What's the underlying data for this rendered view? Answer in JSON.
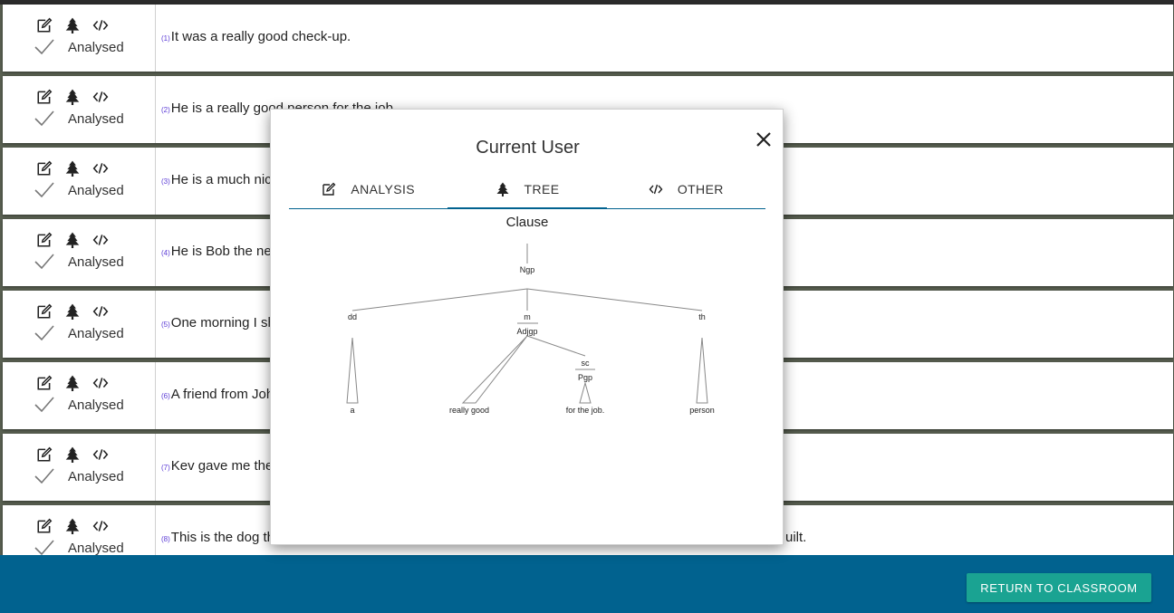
{
  "rows": [
    {
      "num": "(1)",
      "text": "It was a really good check-up.",
      "status": "Analysed"
    },
    {
      "num": "(2)",
      "text": "He is a really good person for the job.",
      "status": "Analysed"
    },
    {
      "num": "(3)",
      "text": "He is a much nic",
      "status": "Analysed"
    },
    {
      "num": "(4)",
      "text": "He is Bob the ne",
      "status": "Analysed"
    },
    {
      "num": "(5)",
      "text": "One morning I sh",
      "status": "Analysed"
    },
    {
      "num": "(6)",
      "text": "A friend from Joh",
      "status": "Analysed"
    },
    {
      "num": "(7)",
      "text": "Kev gave me the",
      "status": "Analysed"
    },
    {
      "num": "(8)",
      "text": "This is the dog th",
      "status": "Analysed",
      "tail": "uilt."
    }
  ],
  "modal": {
    "title": "Current User",
    "tabs": [
      {
        "label": "ANALYSIS",
        "icon": "edit-icon"
      },
      {
        "label": "TREE",
        "icon": "tree-icon",
        "active": true
      },
      {
        "label": "OTHER",
        "icon": "code-icon"
      }
    ],
    "tree": {
      "root": "Clause",
      "ngp": "Ngp",
      "dd": "dd",
      "m": "m",
      "adjgp": "Adjgp",
      "th": "th",
      "sc": "sc",
      "pgp": "Pgp",
      "leaf_a": "a",
      "leaf_really_good": "really good",
      "leaf_for_the_job": "for the job.",
      "leaf_person": "person"
    }
  },
  "footer": {
    "return_label": "RETURN TO CLASSROOM"
  },
  "colors": {
    "accent": "#01628f",
    "button": "#1aa392",
    "number": "#5b3bd6"
  }
}
